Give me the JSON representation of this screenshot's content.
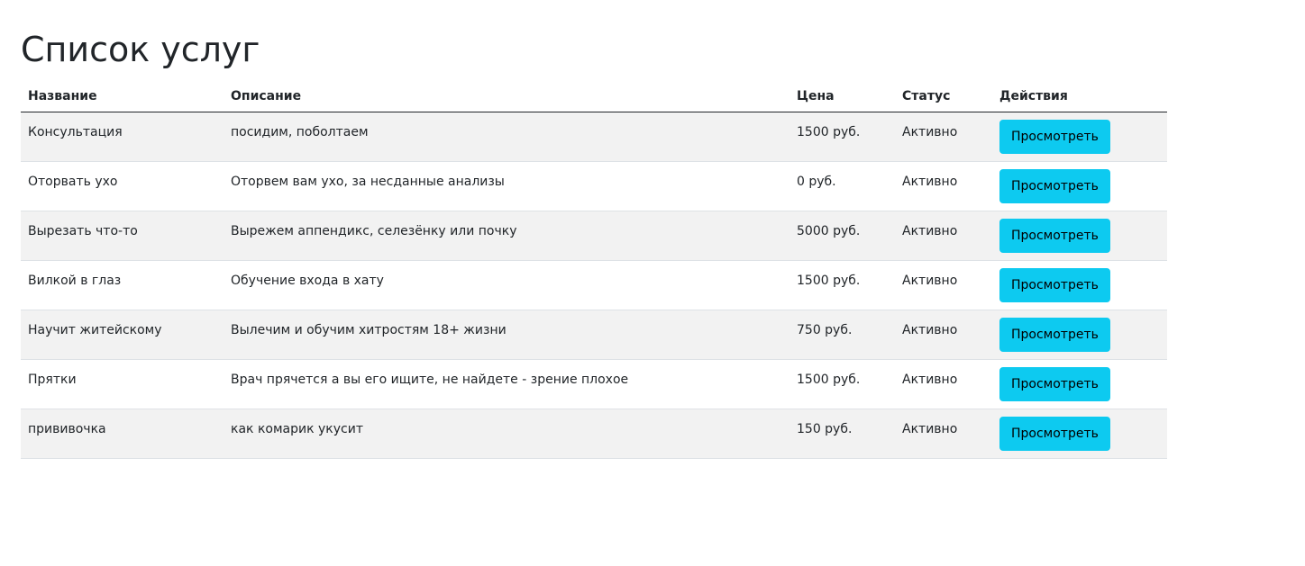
{
  "page": {
    "title": "Список услуг"
  },
  "table": {
    "headers": {
      "name": "Название",
      "description": "Описание",
      "price": "Цена",
      "status": "Статус",
      "actions": "Действия"
    },
    "rows": [
      {
        "name": "Консультация",
        "description": "посидим, поболтаем",
        "price": "1500 руб.",
        "status": "Активно",
        "action_label": "Просмотреть"
      },
      {
        "name": "Оторвать ухо",
        "description": "Оторвем вам ухо, за несданные анализы",
        "price": "0 руб.",
        "status": "Активно",
        "action_label": "Просмотреть"
      },
      {
        "name": "Вырезать что-то",
        "description": "Вырежем аппендикс, селезёнку или почку",
        "price": "5000 руб.",
        "status": "Активно",
        "action_label": "Просмотреть"
      },
      {
        "name": "Вилкой в глаз",
        "description": "Обучение входа в хату",
        "price": "1500 руб.",
        "status": "Активно",
        "action_label": "Просмотреть"
      },
      {
        "name": "Научит житейскому",
        "description": "Вылечим и обучим хитростям 18+ жизни",
        "price": "750 руб.",
        "status": "Активно",
        "action_label": "Просмотреть"
      },
      {
        "name": "Прятки",
        "description": "Врач прячется а вы его ищите, не найдете - зрение плохое",
        "price": "1500 руб.",
        "status": "Активно",
        "action_label": "Просмотреть"
      },
      {
        "name": "прививочка",
        "description": "как комарик укусит",
        "price": "150 руб.",
        "status": "Активно",
        "action_label": "Просмотреть"
      }
    ]
  },
  "colors": {
    "button_bg": "#0dcaf0",
    "stripe_bg": "#f2f2f2",
    "text": "#212529"
  }
}
